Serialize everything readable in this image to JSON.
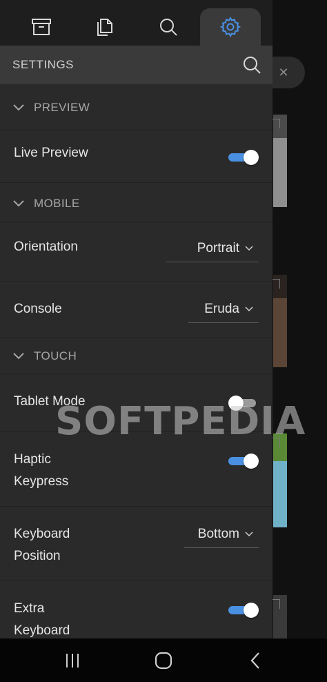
{
  "tabs": [
    {
      "icon": "archive-icon"
    },
    {
      "icon": "documents-icon"
    },
    {
      "icon": "search-icon"
    },
    {
      "icon": "gear-icon",
      "active": true
    }
  ],
  "header": {
    "title": "SETTINGS"
  },
  "sections": {
    "preview": {
      "title": "PREVIEW"
    },
    "mobile": {
      "title": "MOBILE"
    },
    "touch": {
      "title": "TOUCH"
    }
  },
  "settings": {
    "live_preview": {
      "label": "Live Preview",
      "on": true
    },
    "orientation": {
      "label": "Orientation",
      "value": "Portrait"
    },
    "console": {
      "label": "Console",
      "value": "Eruda"
    },
    "tablet_mode": {
      "label": "Tablet Mode",
      "on": false
    },
    "haptic_keypress": {
      "label_line1": "Haptic",
      "label_line2": "Keypress",
      "on": true
    },
    "keyboard_position": {
      "label_line1": "Keyboard",
      "label_line2": "Position",
      "value": "Bottom"
    },
    "extra_keyboard": {
      "label_line1": "Extra",
      "label_line2": "Keyboard",
      "on": true
    }
  },
  "watermark": "SOFTPEDIA",
  "colors": {
    "accent": "#4a90e2",
    "drawer_bg": "#2a2a2a",
    "header_bg": "#3a3a3a"
  }
}
